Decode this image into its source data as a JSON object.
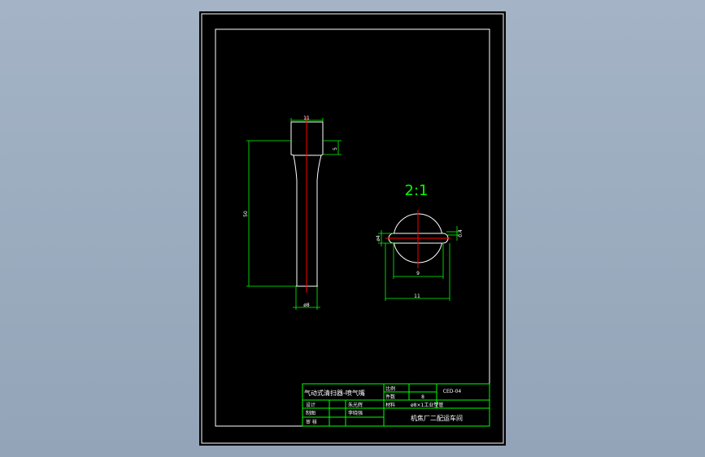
{
  "drawing": {
    "scale_label": "2:1",
    "dimensions": {
      "head_width": "11",
      "head_height": "5",
      "total_length": "50",
      "shaft_diameter": "ø8",
      "section_left": "ø4",
      "section_right": "0.4",
      "section_inner": "9",
      "section_outer": "11"
    }
  },
  "title_block": {
    "part_name": "气动式清扫器-喷气嘴",
    "scale_label": "比例",
    "quantity_label": "件数",
    "quantity_value": "8",
    "drawing_no": "CED-04",
    "designer_label": "设计",
    "designer_name": "朱光辉",
    "material_label": "材料",
    "material_value": "ø8×1工业塑管",
    "drafter_label": "制图",
    "drafter_name": "李晓强",
    "reviewer_label": "审 核",
    "company": "机焦厂二配运车间"
  },
  "colors": {
    "background": "#000000",
    "line": "#ffffff",
    "centerline": "#ff0000",
    "dimension": "#00ff00",
    "title_block": "#00ff00"
  }
}
